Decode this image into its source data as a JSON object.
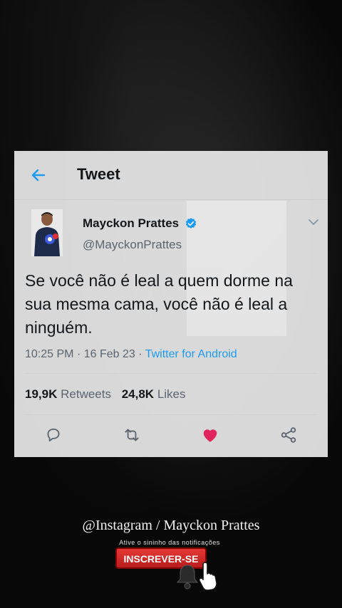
{
  "header": {
    "title": "Tweet"
  },
  "author": {
    "name": "Mayckon Prattes",
    "handle": "@MayckonPrattes"
  },
  "tweet": {
    "text": "Se você não é leal a quem dorme na sua mesma cama, você não é leal a ninguém.",
    "time": "10:25 PM",
    "date": "16 Feb 23",
    "source": "Twitter for Android",
    "separator": "·"
  },
  "stats": {
    "retweets_count": "19,9K",
    "retweets_label": "Retweets",
    "likes_count": "24,8K",
    "likes_label": "Likes"
  },
  "overlay": {
    "watermark": "@Instagram / Mayckon Prattes",
    "notify_text": "Ative o sininho das notificações",
    "subscribe_label": "INSCREVER-SE"
  },
  "colors": {
    "accent": "#1d9bf0",
    "like": "#e0245e",
    "subscribe": "#d32f2f"
  },
  "icons": {
    "back": "arrow-left-icon",
    "verified": "verified-badge-icon",
    "caret": "chevron-down-icon",
    "reply": "reply-icon",
    "retweet": "retweet-icon",
    "like": "heart-icon",
    "share": "share-icon",
    "bell": "bell-icon",
    "hand": "pointer-hand-icon"
  }
}
